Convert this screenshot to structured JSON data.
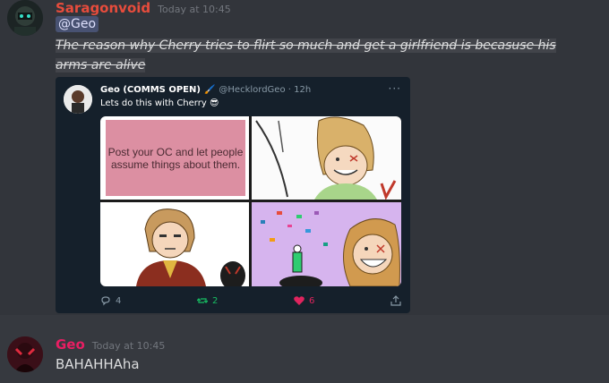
{
  "messages": [
    {
      "username": "Saragonvoid",
      "username_color": "#e74c3c",
      "timestamp": "Today at 10:45",
      "mention": "@Geo",
      "text": "The reason why Cherry tries to flirt so much and get a girlfriend is becasuse his arms are alive",
      "embed": {
        "author_name": "Geo (COMMS OPEN)",
        "author_extra": "🖌️",
        "handle": "@HecklordGeo · 12h",
        "more": "···",
        "text": "Lets do this with Cherry 😎",
        "panel1_text": "Post your OC and let people assume things about them.",
        "reply_count": "4",
        "retweet_count": "2",
        "like_count": "6",
        "accent_reply": "#8899a6",
        "accent_retweet": "#17bf63",
        "accent_like": "#e0245e"
      }
    },
    {
      "username": "Geo",
      "username_color": "#e91e63",
      "timestamp": "Today at 10:45",
      "text": "BAHAHHAha"
    }
  ],
  "icons": {
    "reply": "reply-icon",
    "retweet": "retweet-icon",
    "like": "heart-icon",
    "share": "share-icon"
  }
}
